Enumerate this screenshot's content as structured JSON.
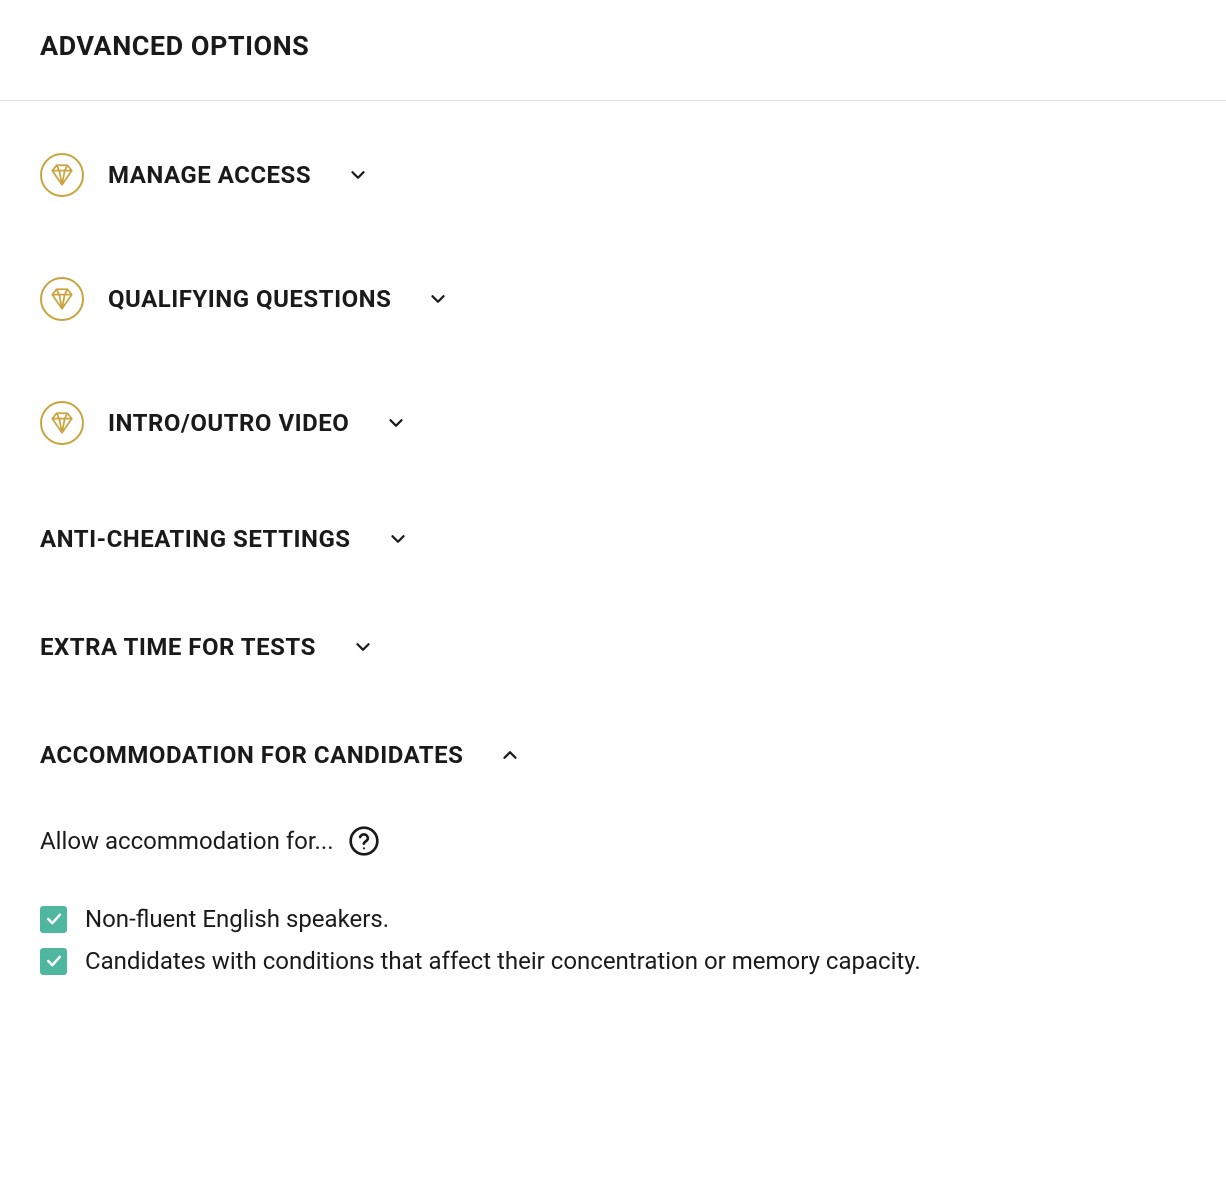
{
  "page_title": "ADVANCED OPTIONS",
  "sections": {
    "manage_access": {
      "title": "MANAGE ACCESS",
      "premium": true,
      "expanded": false
    },
    "qualifying_questions": {
      "title": "QUALIFYING QUESTIONS",
      "premium": true,
      "expanded": false
    },
    "intro_outro_video": {
      "title": "INTRO/OUTRO VIDEO",
      "premium": true,
      "expanded": false
    },
    "anti_cheating": {
      "title": "ANTI-CHEATING SETTINGS",
      "premium": false,
      "expanded": false
    },
    "extra_time": {
      "title": "EXTRA TIME FOR TESTS",
      "premium": false,
      "expanded": false
    },
    "accommodation": {
      "title": "ACCOMMODATION FOR CANDIDATES",
      "premium": false,
      "expanded": true,
      "allow_label": "Allow accommodation for...",
      "options": [
        {
          "label": "Non-fluent English speakers.",
          "checked": true
        },
        {
          "label": "Candidates with conditions that affect their concentration or memory capacity.",
          "checked": true
        }
      ]
    }
  },
  "colors": {
    "premium_gold": "#c9a43f",
    "checkbox_teal": "#4fb6a0",
    "text_dark": "#1a1a1a",
    "border_light": "#e5e5e5"
  }
}
